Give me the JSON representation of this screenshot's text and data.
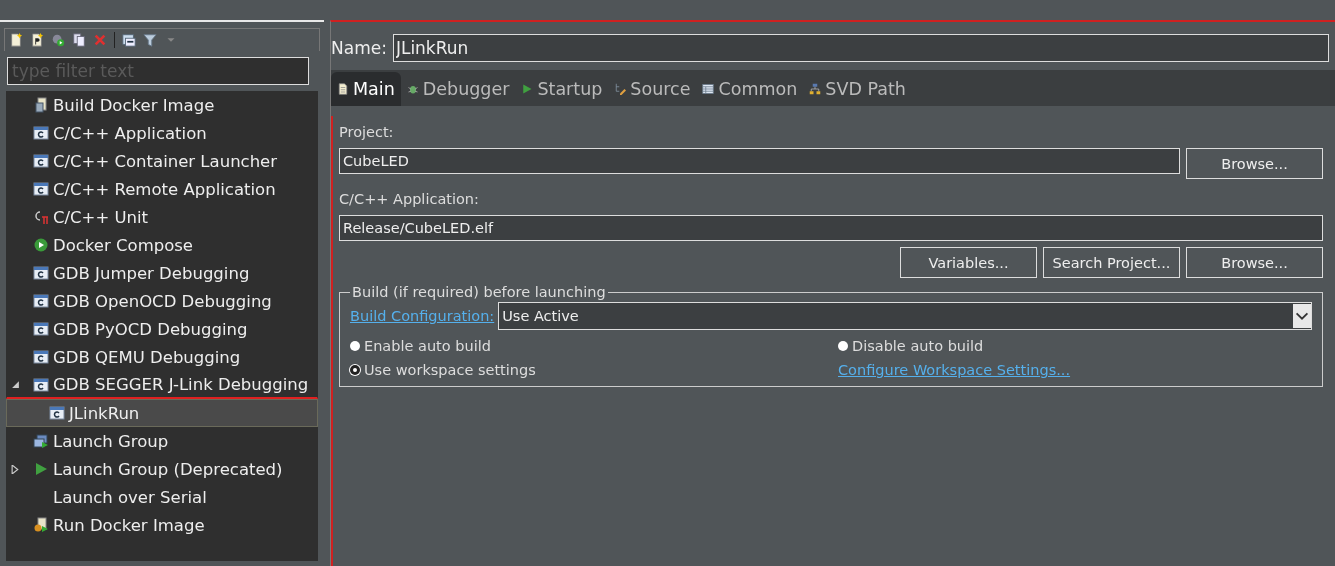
{
  "toolbar": {
    "buttons": [
      {
        "kind": "new"
      },
      {
        "kind": "new-prototype"
      },
      {
        "kind": "export"
      },
      {
        "kind": "duplicate"
      },
      {
        "kind": "delete"
      },
      {
        "kind": "collapse"
      },
      {
        "kind": "filter"
      },
      {
        "kind": "dropdown"
      }
    ]
  },
  "filter": {
    "placeholder": "type filter text"
  },
  "tree": [
    {
      "label": "Build Docker Image",
      "kind": "docker-build",
      "selected": false,
      "highlighted": false
    },
    {
      "label": "C/C++ Application",
      "kind": "c-app",
      "selected": false,
      "highlighted": false
    },
    {
      "label": "C/C++ Container Launcher",
      "kind": "c-app",
      "selected": false,
      "highlighted": false
    },
    {
      "label": "C/C++ Remote Application",
      "kind": "c-app",
      "selected": false,
      "highlighted": false
    },
    {
      "label": "C/C++ Unit",
      "kind": "c-unit",
      "selected": false,
      "highlighted": false
    },
    {
      "label": "Docker Compose",
      "kind": "compose",
      "selected": false,
      "highlighted": false
    },
    {
      "label": "GDB Jumper Debugging",
      "kind": "c-app",
      "selected": false,
      "highlighted": false
    },
    {
      "label": "GDB OpenOCD Debugging",
      "kind": "c-app",
      "selected": false,
      "highlighted": false
    },
    {
      "label": "GDB PyOCD Debugging",
      "kind": "c-app",
      "selected": false,
      "highlighted": false
    },
    {
      "label": "GDB QEMU Debugging",
      "kind": "c-app",
      "selected": false,
      "highlighted": false
    },
    {
      "label": "GDB SEGGER J-Link Debugging",
      "kind": "c-app",
      "expanded": true,
      "selected": false,
      "highlighted": true,
      "children": [
        {
          "label": "JLinkRun",
          "kind": "c-app",
          "selected": true,
          "highlighted": false
        }
      ]
    },
    {
      "label": "Launch Group",
      "kind": "launch-group",
      "selected": false,
      "highlighted": false
    },
    {
      "label": "Launch Group (Deprecated)",
      "kind": "run",
      "expanded": false,
      "selected": false,
      "highlighted": false
    },
    {
      "label": "Launch over Serial",
      "kind": "plain",
      "selected": false,
      "highlighted": false
    },
    {
      "label": "Run Docker Image",
      "kind": "docker-run",
      "selected": false,
      "highlighted": false
    }
  ],
  "name": {
    "label": "Name:",
    "value": "JLinkRun"
  },
  "tabs": [
    {
      "label": "Main",
      "kind": "page",
      "selected": true
    },
    {
      "label": "Debugger",
      "kind": "bug",
      "selected": false
    },
    {
      "label": "Startup",
      "kind": "run",
      "selected": false
    },
    {
      "label": "Source",
      "kind": "source",
      "selected": false
    },
    {
      "label": "Common",
      "kind": "table",
      "selected": false
    },
    {
      "label": "SVD Path",
      "kind": "hierarchy",
      "selected": false
    }
  ],
  "project": {
    "label": "Project:",
    "value": "CubeLED",
    "browse": "Browse..."
  },
  "application": {
    "label": "C/C++ Application:",
    "value": "Release/CubeLED.elf"
  },
  "app_buttons": [
    "Variables...",
    "Search Project...",
    "Browse..."
  ],
  "build": {
    "title": "Build (if required) before launching",
    "config_link": "Build Configuration:",
    "config_value": "Use Active",
    "options": [
      {
        "label": "Enable auto build",
        "selected": false
      },
      {
        "label": "Disable auto build",
        "selected": false
      },
      {
        "label": "Use workspace settings",
        "selected": true
      }
    ],
    "workspace_link": "Configure Workspace Settings..."
  }
}
